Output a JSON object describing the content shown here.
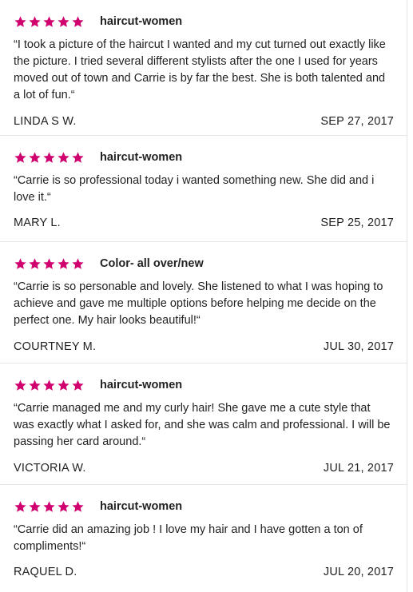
{
  "colors": {
    "star": "#d0006f",
    "text": "#222222",
    "divider": "#e6e6e6"
  },
  "rating_icon": "star-icon",
  "reviews": [
    {
      "rating": 5,
      "service": "haircut-women",
      "quote": "“I took a picture of the haircut I wanted and my cut turned out exactly like the picture.  I tried several different stylists after the one I used for years moved out of town and Carrie is by far the best.  She is both talented and a lot of fun.“",
      "author": "LINDA S W.",
      "date": "SEP 27, 2017"
    },
    {
      "rating": 5,
      "service": "haircut-women",
      "quote": "“Carrie is so professional today i wanted something new. She did and i love it.“",
      "author": "MARY L.",
      "date": "SEP 25, 2017"
    },
    {
      "rating": 5,
      "service": "Color- all over/new",
      "quote": "“Carrie is so personable and lovely. She listened to what I was hoping to achieve and gave me multiple options before helping me decide on the perfect one. My hair looks beautiful!“",
      "author": "COURTNEY M.",
      "date": "JUL 30, 2017"
    },
    {
      "rating": 5,
      "service": "haircut-women",
      "quote": "“Carrie managed me and my curly hair!  She gave me a cute style that was exactly what I asked for, and she was calm and professional.  I will be passing her card around.“",
      "author": "VICTORIA W.",
      "date": "JUL 21, 2017"
    },
    {
      "rating": 5,
      "service": "haircut-women",
      "quote": "“Carrie did an amazing job ! I love my hair and I have gotten a ton of compliments!“",
      "author": "RAQUEL D.",
      "date": "JUL 20, 2017"
    }
  ]
}
